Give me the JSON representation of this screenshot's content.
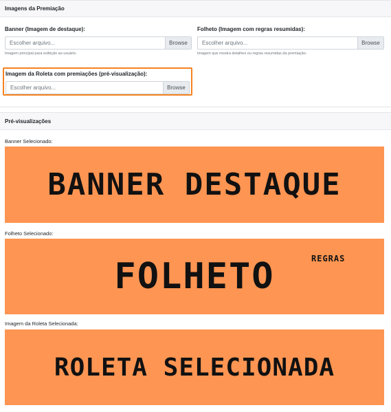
{
  "sections": {
    "images_title": "Imagens da Premiação",
    "previews_title": "Pré-visualizações"
  },
  "fields": {
    "banner": {
      "label": "Banner (Imagem de destaque):",
      "placeholder": "Escolher arquivo...",
      "browse": "Browse",
      "help": "Imagem principal para exibição ao usuário."
    },
    "folheto": {
      "label": "Folheto (Imagem com regras resumidas):",
      "placeholder": "Escolher arquivo...",
      "browse": "Browse",
      "help": "Imagem que mostra detalhes ou regras resumidas da premiação."
    },
    "roleta": {
      "label": "Imagem da Roleta com premiações (pré-visualização):",
      "placeholder": "Escolher arquivo...",
      "browse": "Browse"
    }
  },
  "previews": {
    "banner": {
      "label": "Banner Selecionado:",
      "text": "Banner destaque"
    },
    "folheto": {
      "label": "Folheto Selecionado:",
      "text": "Folheto",
      "subtext": "REGRAS"
    },
    "roleta": {
      "label": "Imagem da Roleta Selecionada:",
      "text": "Roleta selecionada"
    }
  },
  "colors": {
    "highlight": "#f5821f",
    "preview_bg": "#fe9552"
  }
}
